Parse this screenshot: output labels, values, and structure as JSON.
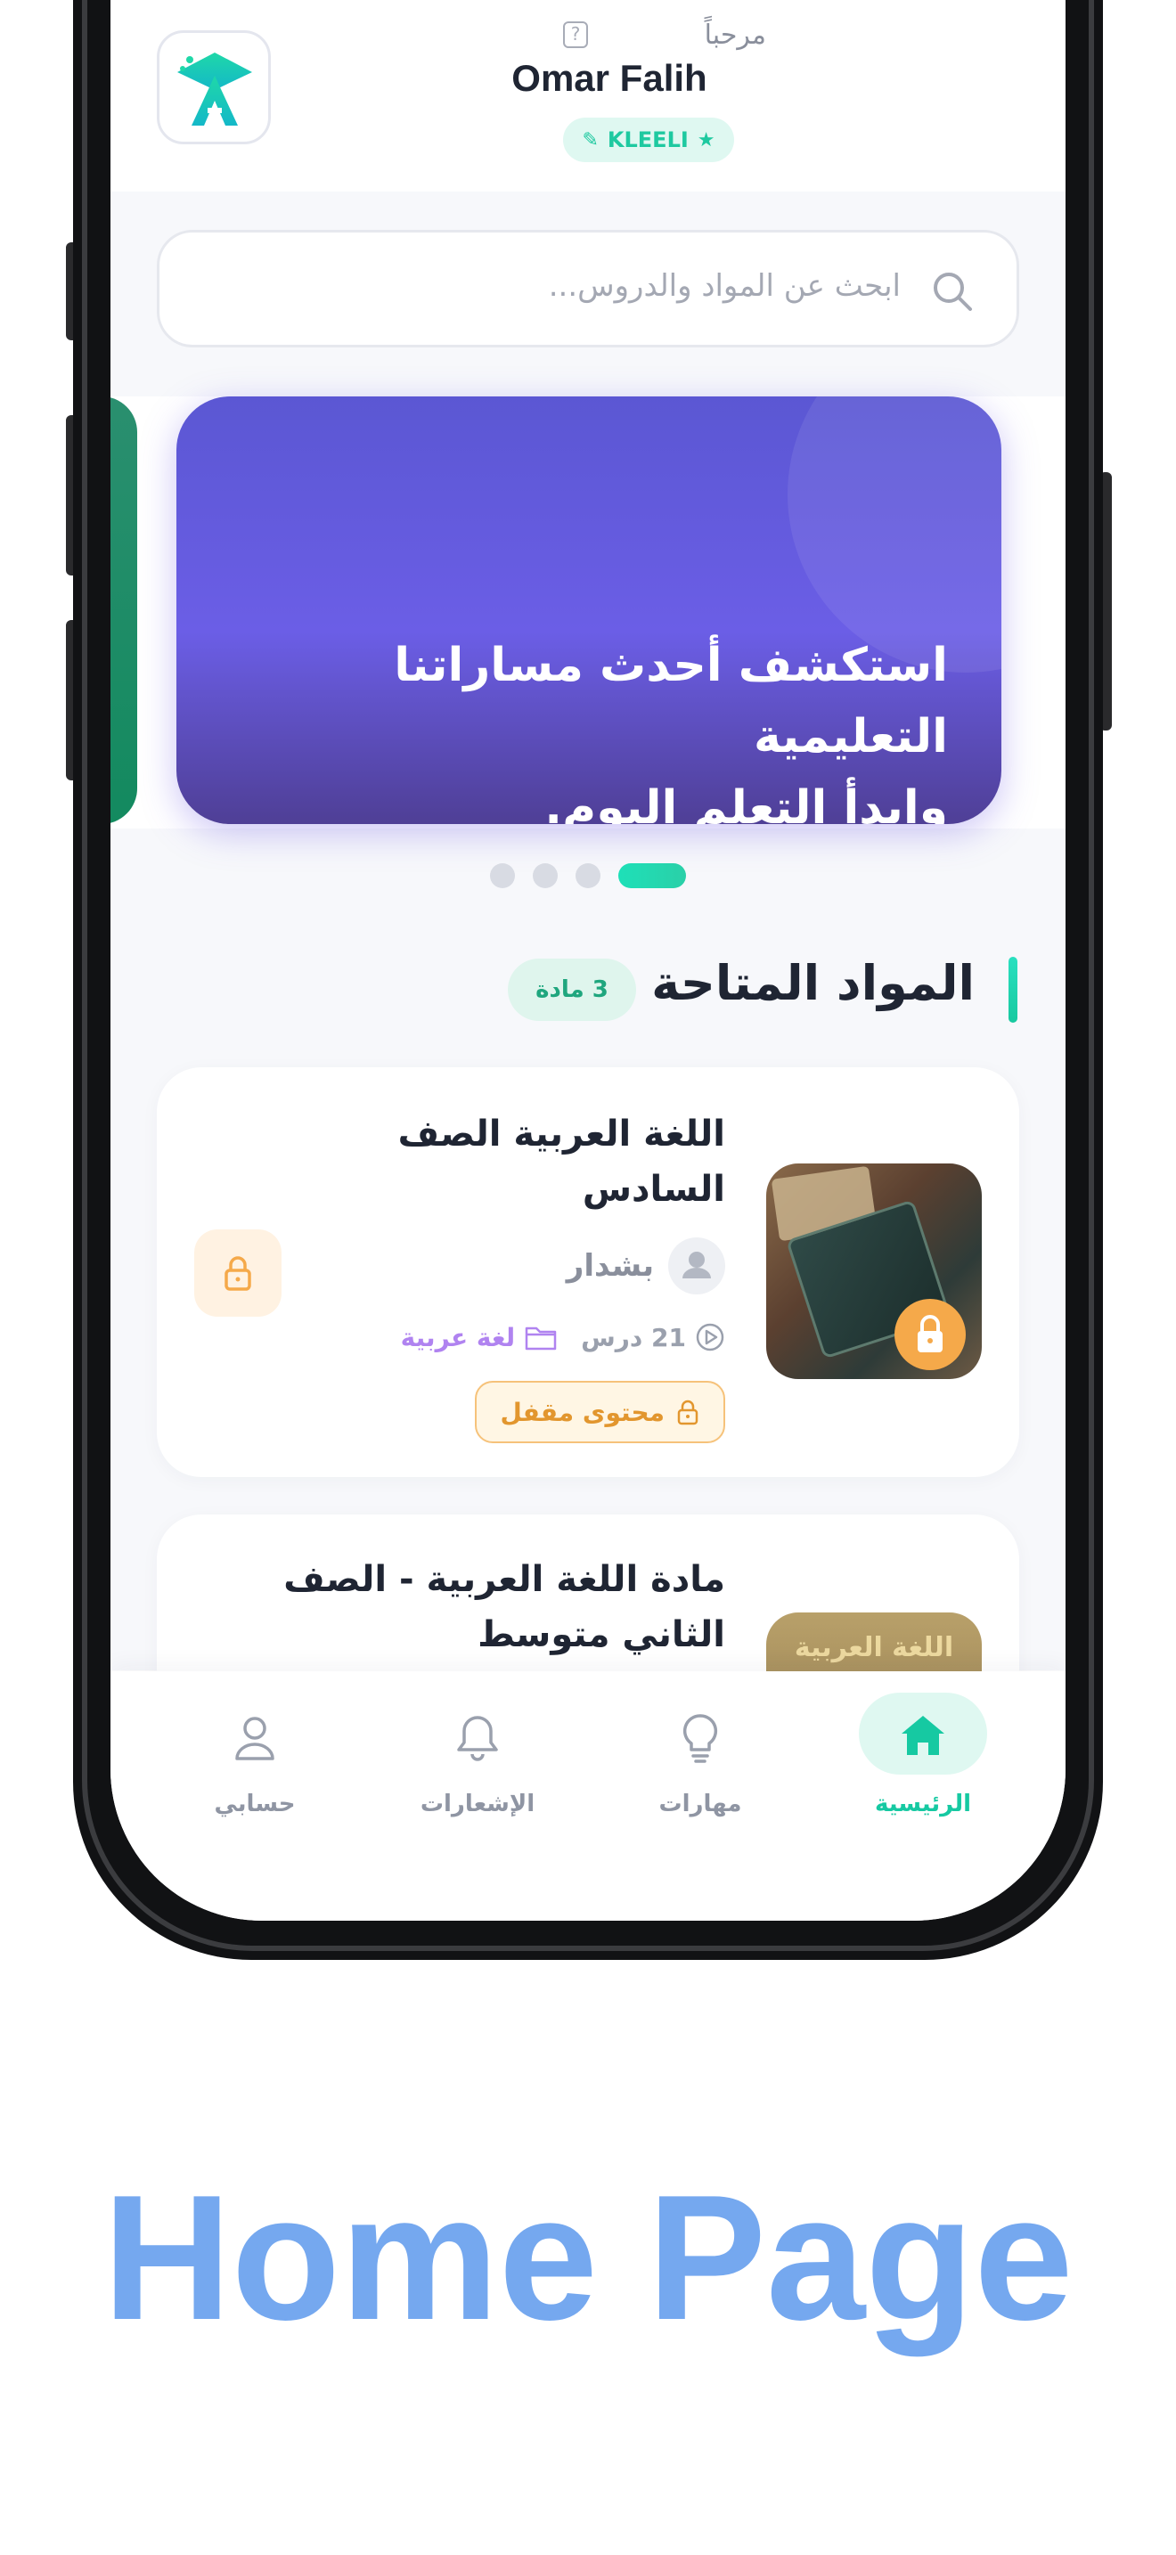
{
  "header": {
    "greeting": "مرحباً",
    "username": "Omar Falih",
    "badge_label": "KLEELI"
  },
  "search": {
    "placeholder": "ابحث عن المواد والدروس..."
  },
  "banner": {
    "line1": "استكشف أحدث مساراتنا التعليمية",
    "line2": "وابدأ التعلم اليوم.",
    "slide_count": 4,
    "active_slide": 4
  },
  "section": {
    "title": "المواد المتاحة",
    "count_label": "3 مادة"
  },
  "courses": [
    {
      "title": "اللغة العربية الصف السادس",
      "author": "بشدار",
      "lessons": "21 درس",
      "category": "لغة عربية",
      "status": "محتوى مقفل"
    },
    {
      "title": "مادة اللغة العربية - الصف الثاني متوسط"
    }
  ],
  "nav": {
    "items": [
      {
        "label": "الرئيسية",
        "icon": "home-icon",
        "active": true
      },
      {
        "label": "مهارات",
        "icon": "lightbulb-icon",
        "active": false
      },
      {
        "label": "الإشعارات",
        "icon": "bell-icon",
        "active": false
      },
      {
        "label": "حسابي",
        "icon": "user-icon",
        "active": false
      }
    ]
  },
  "caption": "Home Page",
  "colors": {
    "accent": "#1ec9a0",
    "banner": "#6b5ee6",
    "lock": "#f5a94a",
    "caption": "#75a8ef"
  }
}
